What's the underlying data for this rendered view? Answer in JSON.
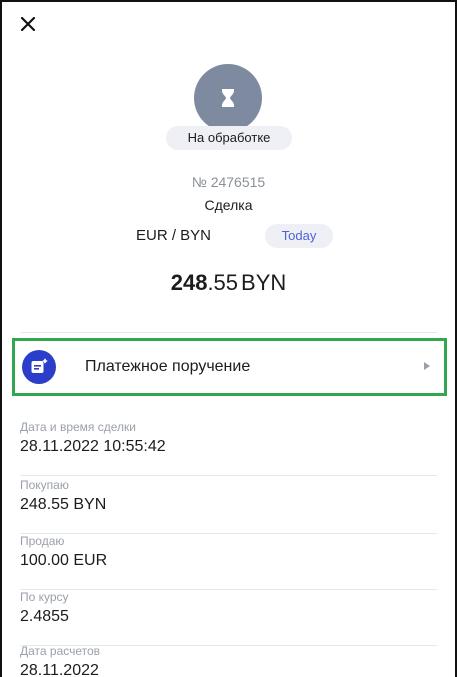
{
  "icons": {
    "close": "close-icon",
    "status": "hourglass-icon",
    "payment_order": "document-add-icon",
    "arrow": "chevron-right-icon"
  },
  "colors": {
    "status_circle": "#7e8aa0",
    "accent": "#4a64d6",
    "payment_icon_bg": "#2b3ec9",
    "highlight_border": "#2fa84f"
  },
  "status": {
    "label": "На обработке"
  },
  "deal": {
    "number": "№ 2476515",
    "type": "Сделка",
    "pair": "EUR / BYN",
    "badge": "Today",
    "amount_whole": "248",
    "amount_frac": ".55",
    "amount_currency": "BYN"
  },
  "payment_order": {
    "label": "Платежное поручение"
  },
  "details": [
    {
      "label": "Дата и время сделки",
      "value": "28.11.2022 10:55:42"
    },
    {
      "label": "Покупаю",
      "value": "248.55 BYN"
    },
    {
      "label": "Продаю",
      "value": "100.00 EUR"
    },
    {
      "label": "По курсу",
      "value": "2.4855"
    },
    {
      "label": "Дата расчетов",
      "value": "28.11.2022"
    }
  ]
}
